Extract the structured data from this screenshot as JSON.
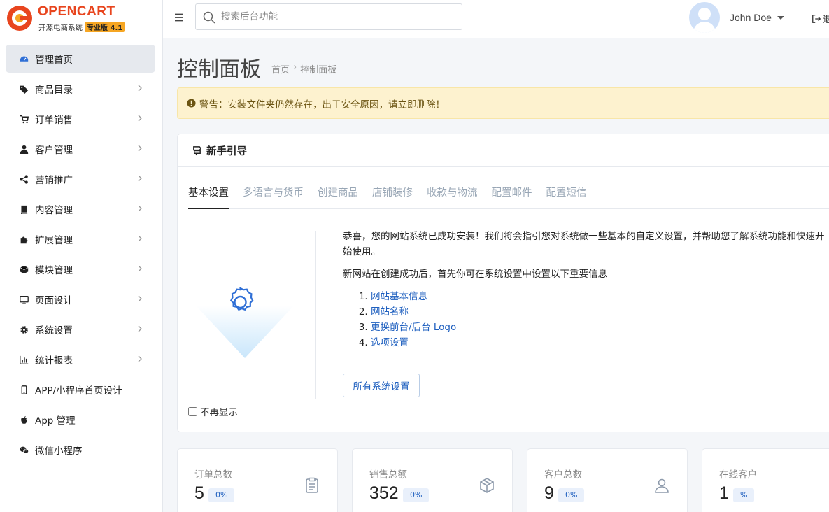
{
  "logo": {
    "brand": "OPENCART",
    "tagline": "开源电商系统",
    "badge": "专业版 4.1"
  },
  "sidebar": {
    "items": [
      {
        "label": "管理首页",
        "icon": "dashboard-icon",
        "active": true,
        "chevron": false
      },
      {
        "label": "商品目录",
        "icon": "tags-icon",
        "chevron": true
      },
      {
        "label": "订单销售",
        "icon": "cart-icon",
        "chevron": true
      },
      {
        "label": "客户管理",
        "icon": "user-icon",
        "chevron": true
      },
      {
        "label": "营销推广",
        "icon": "share-icon",
        "chevron": true
      },
      {
        "label": "内容管理",
        "icon": "book-icon",
        "chevron": true
      },
      {
        "label": "扩展管理",
        "icon": "puzzle-icon",
        "chevron": true
      },
      {
        "label": "模块管理",
        "icon": "cube-icon",
        "chevron": true
      },
      {
        "label": "页面设计",
        "icon": "monitor-icon",
        "chevron": true
      },
      {
        "label": "系统设置",
        "icon": "gear-icon",
        "chevron": true
      },
      {
        "label": "统计报表",
        "icon": "chart-icon",
        "chevron": true
      },
      {
        "label": "APP/小程序首页设计",
        "icon": "mobile-icon",
        "chevron": false
      },
      {
        "label": "App 管理",
        "icon": "apple-icon",
        "chevron": false
      },
      {
        "label": "微信小程序",
        "icon": "wechat-icon",
        "chevron": false
      }
    ]
  },
  "header": {
    "search_placeholder": "搜索后台功能",
    "username": "John Doe",
    "logout_label": "退"
  },
  "main": {
    "title": "控制面板",
    "breadcrumb": [
      "首页",
      "控制面板"
    ],
    "alert": "警告：安装文件夹仍然存在，出于安全原因，请立即删除！",
    "guide": {
      "title": "新手引导",
      "tabs": [
        "基本设置",
        "多语言与货币",
        "创建商品",
        "店铺装修",
        "收款与物流",
        "配置邮件",
        "配置短信"
      ],
      "intro": "恭喜，您的网站系统已成功安装！我们将会指引您对系统做一些基本的自定义设置，并帮助您了解系统功能和快速开始使用。",
      "subtitle": "新网站在创建成功后，首先你可在系统设置中设置以下重要信息",
      "links": [
        "网站基本信息",
        "网站名称",
        "更换前台/后台 Logo",
        "选项设置"
      ],
      "button": "所有系统设置",
      "dont_show": "不再显示"
    },
    "stats": [
      {
        "label": "订单总数",
        "value": "5",
        "pct": "0%",
        "icon": "clipboard-icon"
      },
      {
        "label": "销售总额",
        "value": "352",
        "pct": "0%",
        "icon": "box-icon"
      },
      {
        "label": "客户总数",
        "value": "9",
        "pct": "0%",
        "icon": "user-outline-icon"
      },
      {
        "label": "在线客户",
        "value": "1",
        "pct": "%",
        "icon": "online-icon"
      }
    ]
  }
}
